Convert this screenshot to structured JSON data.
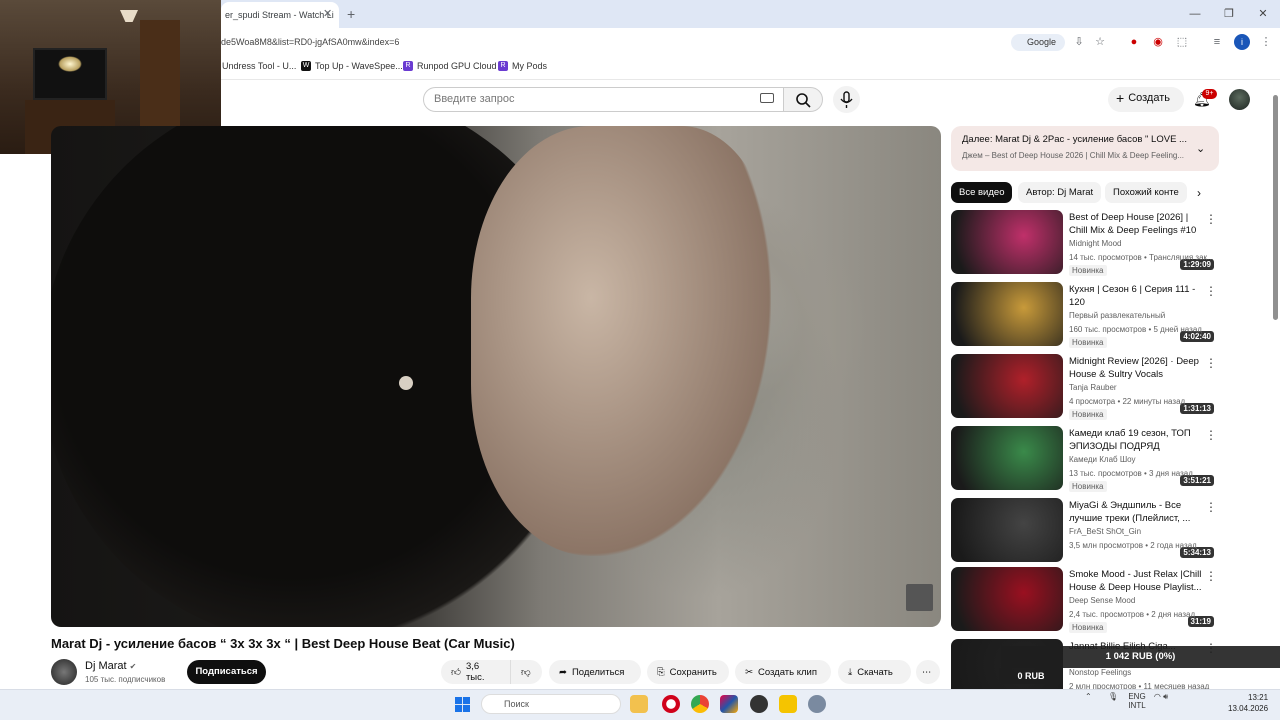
{
  "browser": {
    "tab_title": "er_spudi Stream - Watch Li",
    "tab_close": "✕",
    "new_tab": "+",
    "url": "de5Woa8M8&list=RD0-jgAfSA0mw&index=6",
    "search_engine": "Google",
    "bookmarks": [
      "Undress Tool - U...",
      "Top Up - WaveSpee...",
      "Runpod GPU Cloud",
      "My Pods"
    ],
    "profile_initial": "i"
  },
  "header": {
    "search_placeholder": "Введите запрос",
    "create_label": "Создать",
    "notif_badge": "9+"
  },
  "video": {
    "title": "Marat Dj - усиление басов “ 3х 3х 3х “ | Best Deep House Beat (Car Music)",
    "channel": "Dj Marat",
    "subscribers": "105 тыс. подписчиков",
    "subscribe_label": "Подписаться",
    "likes": "3,6 тыс.",
    "share_label": "Поделиться",
    "save_label": "Сохранить",
    "clip_label": "Создать клип",
    "download_label": "Скачать"
  },
  "sidebar": {
    "up_next_title": "Далее: Marat Dj & 2Pac - усиление басов \" LOVE ...",
    "up_next_sub": "Джем – Best of Deep House 2026 | Chill Mix & Deep Feeling...",
    "chips": [
      "Все видео",
      "Автор: Dj Marat",
      "Похожий конте"
    ],
    "recommendations": [
      {
        "title": "Best of Deep House [2026] | Chill Mix & Deep Feelings #10",
        "channel": "Midnight Mood",
        "meta": "14 тыс. просмотров • Трансляция зак...",
        "badge": "Новинка",
        "duration": "1:29:09",
        "color": "#c0306a"
      },
      {
        "title": "Кухня | Сезон 6 | Серия 111 - 120",
        "channel": "Первый развлекательный",
        "meta": "160 тыс. просмотров • 5 дней назад",
        "badge": "Новинка",
        "duration": "4:02:40",
        "color": "#c89a3a"
      },
      {
        "title": "Midnight Review [2026] · Deep House & Sultry Vocals (Intimat...",
        "channel": "Tanja Rauber",
        "meta": "4 просмотра • 22 минуты назад",
        "badge": "Новинка",
        "duration": "1:31:13",
        "color": "#b0202a"
      },
      {
        "title": "Камеди клаб 19 сезон, ТОП ЭПИЗОДЫ ПОДРЯД",
        "channel": "Камеди Клаб Шоу",
        "meta": "13 тыс. просмотров • 3 дня назад",
        "badge": "Новинка",
        "duration": "3:51:21",
        "color": "#3a8a4a"
      },
      {
        "title": "MiyaGi & Эндшпиль - Все лучшие треки (Плейлист, ...",
        "channel": "FrA_BeSt ShOt_Gin",
        "meta": "3,5 млн просмотров • 2 года назад",
        "badge": "",
        "duration": "5:34:13",
        "color": "#444444"
      },
      {
        "title": "Smoke Mood - Just Relax |Chill House & Deep House Playlist...",
        "channel": "Deep Sense Mood",
        "meta": "2,4 тыс. просмотров • 2 дня назад",
        "badge": "Новинка",
        "duration": "31:19",
        "color": "#9a1020"
      },
      {
        "title": "Jannat Billie Eilish Ciga...",
        "channel": "Nonstop Feelings",
        "meta": "2 млн просмотров • 11 месяцев назад",
        "badge": "",
        "duration": "",
        "color": "#222222"
      }
    ]
  },
  "overlay": {
    "balance": "1 042 RUB (0%)",
    "small": "0 RUB"
  },
  "taskbar": {
    "search_label": "Поиск",
    "lang_top": "ENG",
    "lang_bottom": "INTL",
    "time": "13:21",
    "date": "13.04.2026"
  }
}
